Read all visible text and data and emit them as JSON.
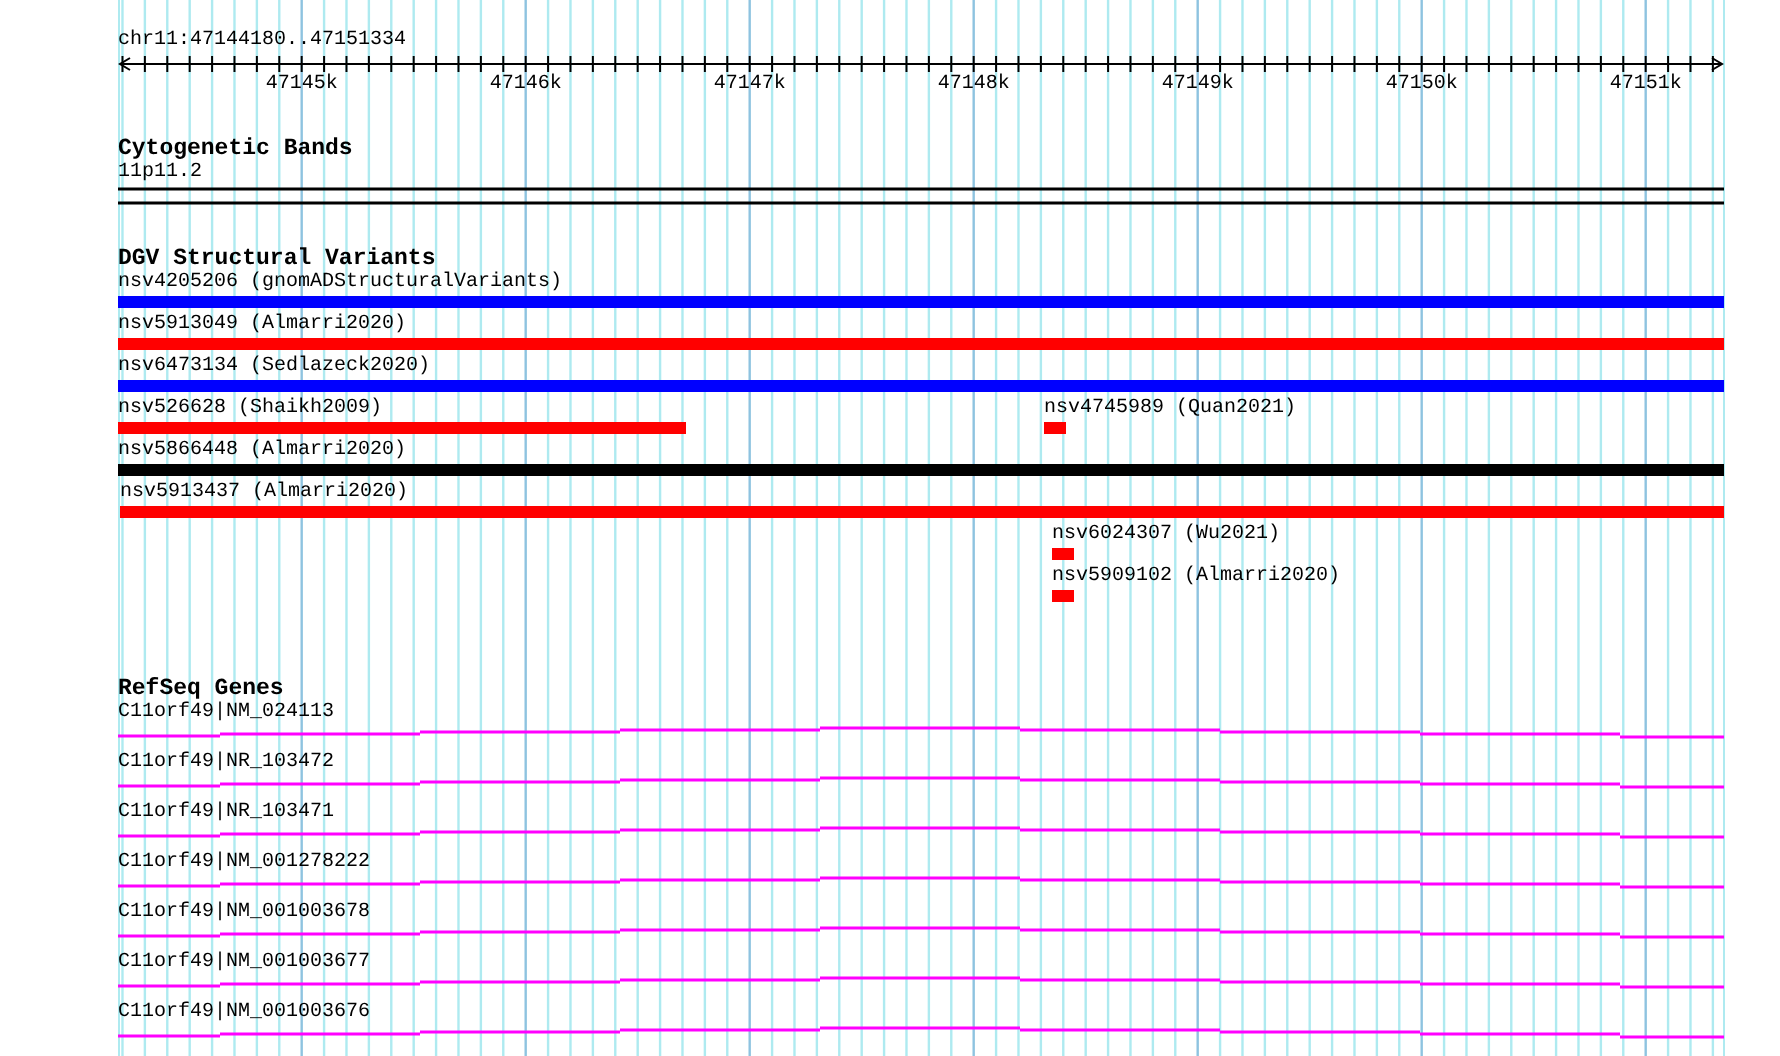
{
  "ruler": {
    "location": "chr11:47144180..47151334",
    "ticks": [
      "47145k",
      "47146k",
      "47147k",
      "47148k",
      "47149k",
      "47150k",
      "47151k"
    ]
  },
  "tracks": [
    {
      "kind": "bands",
      "title": "Cytogenetic Bands",
      "bands": [
        "11p11.2"
      ]
    },
    {
      "kind": "variants",
      "title": "DGV Structural Variants",
      "lanes": [
        [
          {
            "label": "nsv4205206 (gnomADStructuralVariants)",
            "color": "#0000ff"
          }
        ],
        [
          {
            "label": "nsv5913049 (Almarri2020)",
            "color": "#ff0000"
          }
        ],
        [
          {
            "label": "nsv6473134 (Sedlazeck2020)",
            "color": "#0000ff"
          }
        ],
        [
          {
            "label": "nsv526628 (Shaikh2009)",
            "color": "#ff0000"
          },
          {
            "label": "nsv4745989 (Quan2021)",
            "color": "#ff0000"
          }
        ],
        [
          {
            "label": "nsv5866448 (Almarri2020)",
            "color": "#000000"
          }
        ],
        [
          {
            "label": "nsv5913437 (Almarri2020)",
            "color": "#ff0000"
          }
        ],
        [
          {
            "label": "nsv6024307 (Wu2021)",
            "color": "#ff0000"
          }
        ],
        [
          {
            "label": "nsv5909102 (Almarri2020)",
            "color": "#ff0000"
          }
        ]
      ]
    },
    {
      "kind": "genes",
      "title": "RefSeq Genes",
      "genes": [
        "C11orf49|NM_024113",
        "C11orf49|NR_103472",
        "C11orf49|NR_103471",
        "C11orf49|NM_001278222",
        "C11orf49|NM_001003678",
        "C11orf49|NM_001003677",
        "C11orf49|NM_001003676"
      ]
    }
  ]
}
